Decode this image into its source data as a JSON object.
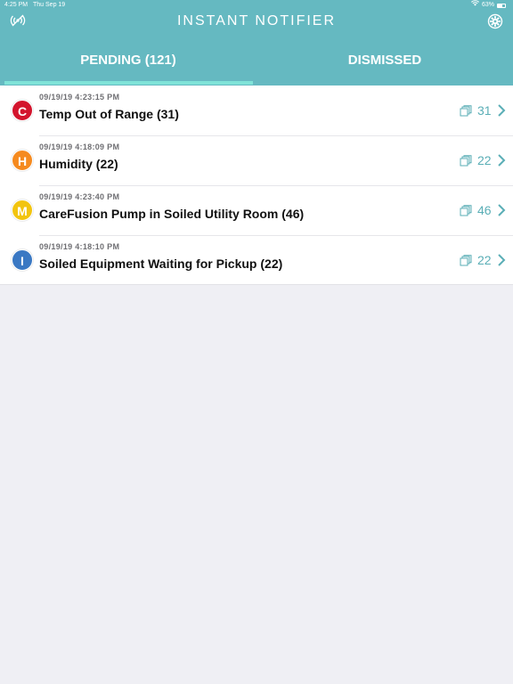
{
  "status_bar": {
    "time": "4:25 PM",
    "date": "Thu Sep 19",
    "battery": "63%"
  },
  "header": {
    "title": "INSTANT NOTIFIER",
    "left_icon": "broadcast-icon",
    "right_icon": "gear-icon",
    "color": "#65b9c1"
  },
  "tabs": [
    {
      "label": "PENDING (121)",
      "active": true
    },
    {
      "label": "DISMISSED",
      "active": false
    }
  ],
  "notifications": [
    {
      "letter": "C",
      "color": "#d3152d",
      "timestamp": "09/19/19 4:23:15 PM",
      "title": "Temp Out of Range (31)",
      "count": "31"
    },
    {
      "letter": "H",
      "color": "#f58a1f",
      "timestamp": "09/19/19 4:18:09 PM",
      "title": "Humidity (22)",
      "count": "22"
    },
    {
      "letter": "M",
      "color": "#f2c40f",
      "timestamp": "09/19/19 4:23:40 PM",
      "title": "CareFusion Pump in Soiled Utility Room (46)",
      "count": "46"
    },
    {
      "letter": "I",
      "color": "#3a78c3",
      "timestamp": "09/19/19 4:18:10 PM",
      "title": "Soiled Equipment Waiting for Pickup (22)",
      "count": "22"
    }
  ]
}
